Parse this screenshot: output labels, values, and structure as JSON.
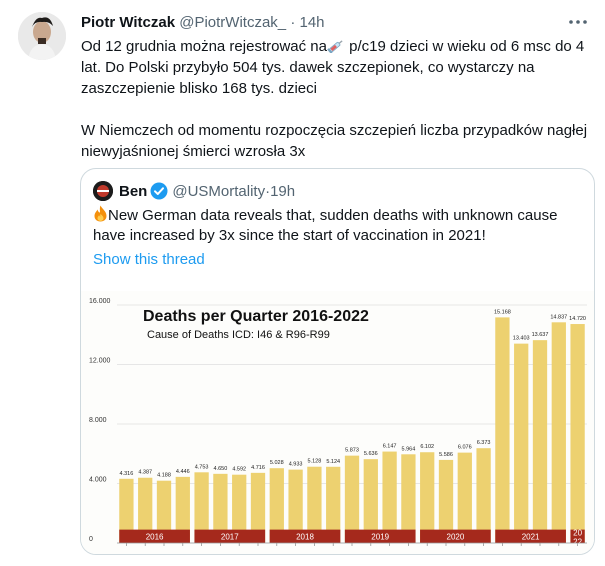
{
  "tweet": {
    "author_name": "Piotr Witczak",
    "author_handle": "@PiotrWitczak_",
    "separator": "·",
    "time": "14h",
    "text_line1_before": "Od 12 grudnia można rejestrować na",
    "text_line1_after": " p/c19 dzieci w wieku od 6 msc do 4 lat. Do Polski przybyło 504 tys. dawek szczepionek, co wystarczy na zaszczepienie blisko 168 tys. dzieci",
    "text_para2": "W Niemczech od momentu rozpoczęcia szczepień liczba przypadków nagłej niewyjaśnionej śmierci wzrosła 3x",
    "icons": {
      "more": "more-icon",
      "inline_emoji": "syringe-icon"
    }
  },
  "quote": {
    "author_name": "Ben",
    "author_handle": "@USMortality",
    "separator": "·",
    "time": "19h",
    "text": "New German data reveals that, sudden deaths with unknown cause have increased by 3x since the start of vaccination in 2021!",
    "show_thread": "Show this thread",
    "icons": {
      "verified": "verified-badge-icon",
      "inline_emoji": "fire-icon"
    }
  },
  "chart_data": {
    "type": "bar",
    "title": "Deaths per Quarter 2016-2022",
    "subtitle": "Cause of Deaths ICD: I46 & R96-R99",
    "ylim": [
      0,
      16000
    ],
    "yticks": [
      "0",
      "4.000",
      "8.000",
      "12.000",
      "16.000"
    ],
    "ytick_values": [
      0,
      4000,
      8000,
      12000,
      16000
    ],
    "values": [
      4316,
      4387,
      4188,
      4446,
      4753,
      4650,
      4592,
      4716,
      5028,
      4933,
      5128,
      5124,
      5873,
      5636,
      6147,
      5964,
      6102,
      5586,
      6076,
      6373,
      15168,
      13403,
      13637,
      14837,
      14720
    ],
    "value_labels": [
      "4.316",
      "4.387",
      "4.188",
      "4.446",
      "4.753",
      "4.650",
      "4.592",
      "4.716",
      "5.028",
      "4.933",
      "5.128",
      "5.124",
      "5.873",
      "5.636",
      "6.147",
      "5.964",
      "6.102",
      "5.586",
      "6.076",
      "6.373",
      "15.168",
      "13.403",
      "13.637",
      "14.837",
      "14.720"
    ],
    "years": [
      {
        "label": "2016",
        "quarters": 4
      },
      {
        "label": "2017",
        "quarters": 4
      },
      {
        "label": "2018",
        "quarters": 4
      },
      {
        "label": "2019",
        "quarters": 4
      },
      {
        "label": "2020",
        "quarters": 4
      },
      {
        "label": "2021",
        "quarters": 4
      },
      {
        "label": "20\n22",
        "quarters": 1
      }
    ],
    "colors": {
      "bar": "#edd170",
      "band": "#a5291c",
      "band_text": "#ffffff",
      "grid": "#e6e6e6"
    },
    "grid": true
  }
}
